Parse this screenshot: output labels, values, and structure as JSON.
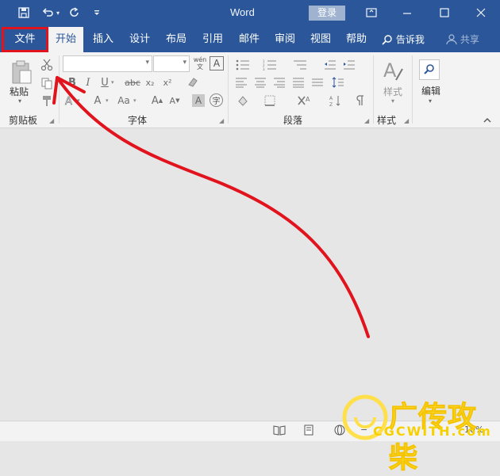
{
  "title_bar": {
    "app_title": "Word",
    "login_label": "登录",
    "icons": [
      "save-icon",
      "undo-icon",
      "redo-icon",
      "customize-qat-icon",
      "ribbon-display-icon",
      "minimize-icon",
      "maximize-icon",
      "close-icon"
    ]
  },
  "tabs": {
    "file": "文件",
    "items": [
      "开始",
      "插入",
      "设计",
      "布局",
      "引用",
      "邮件",
      "审阅",
      "视图",
      "帮助"
    ],
    "active": "开始",
    "tell_me": "告诉我",
    "share": "共享"
  },
  "ribbon": {
    "clipboard": {
      "paste_label": "粘贴",
      "group_label": "剪贴板"
    },
    "font": {
      "group_label": "字体",
      "font_name_value": "",
      "font_size_value": "",
      "phonetic_guide": "wén 文",
      "bold": "B",
      "italic": "I",
      "underline": "U",
      "strikethrough": "abc",
      "subscript": "x₂",
      "superscript": "x²",
      "font_color": "A",
      "change_case": "Aa",
      "grow_font": "A",
      "shrink_font": "A",
      "char_shading": "A",
      "enclose": "字"
    },
    "paragraph": {
      "group_label": "段落"
    },
    "styles": {
      "group_label": "样式",
      "styles_label": "样式"
    },
    "editing": {
      "editing_label": "编辑"
    }
  },
  "status_bar": {
    "zoom": "10%"
  },
  "watermark": {
    "text": "广传攻柴",
    "url": "CGCWITH.com"
  },
  "colors": {
    "brand": "#2b579a",
    "highlight": "#e1141e",
    "watermark": "#ffe04a"
  }
}
